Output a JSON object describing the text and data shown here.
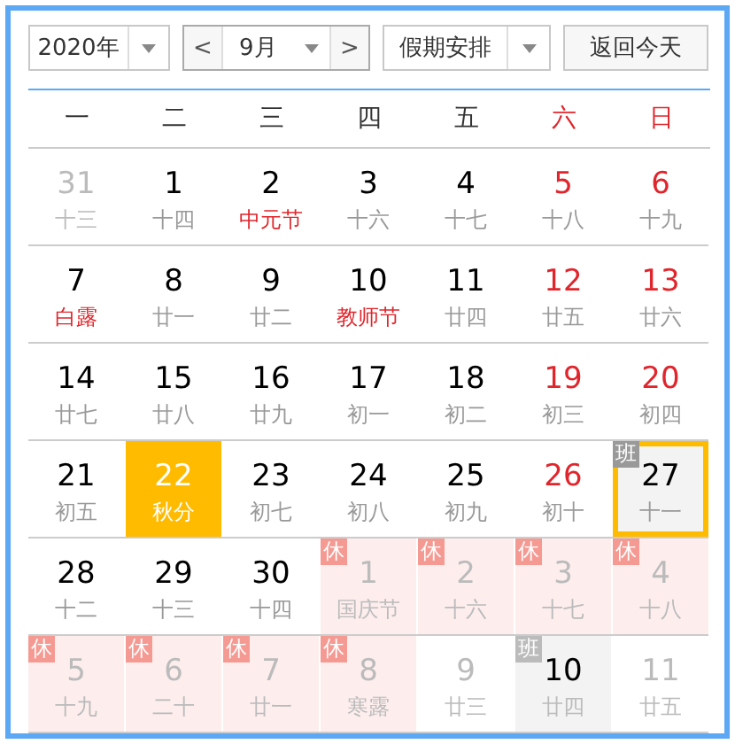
{
  "toolbar": {
    "year": {
      "value": "2020年"
    },
    "month": {
      "prev": "<",
      "value": "9月",
      "next": ">"
    },
    "holiday": {
      "value": "假期安排"
    },
    "today_button": "返回今天"
  },
  "weekdays": [
    {
      "label": "一",
      "weekend": false
    },
    {
      "label": "二",
      "weekend": false
    },
    {
      "label": "三",
      "weekend": false
    },
    {
      "label": "四",
      "weekend": false
    },
    {
      "label": "五",
      "weekend": false
    },
    {
      "label": "六",
      "weekend": true
    },
    {
      "label": "日",
      "weekend": true
    }
  ],
  "days": [
    {
      "kind": "normal",
      "day": "31",
      "lunar": "十三",
      "in_month": false,
      "festival": false,
      "selected": false,
      "highlighted": false,
      "today": false
    },
    {
      "kind": "normal",
      "day": "1",
      "lunar": "十四",
      "in_month": true,
      "weekend": false,
      "festival": false,
      "selected": false,
      "highlighted": false,
      "today": false
    },
    {
      "kind": "normal",
      "day": "2",
      "lunar": "中元节",
      "in_month": true,
      "weekend": false,
      "festival": true,
      "selected": false,
      "highlighted": false,
      "today": false
    },
    {
      "kind": "normal",
      "day": "3",
      "lunar": "十六",
      "in_month": true,
      "weekend": false,
      "festival": false,
      "selected": false,
      "highlighted": false,
      "today": false
    },
    {
      "kind": "normal",
      "day": "4",
      "lunar": "十七",
      "in_month": true,
      "weekend": false,
      "festival": false,
      "selected": false,
      "highlighted": false,
      "today": false
    },
    {
      "kind": "normal",
      "day": "5",
      "lunar": "十八",
      "in_month": true,
      "weekend": true,
      "festival": false,
      "selected": false,
      "highlighted": false,
      "today": false
    },
    {
      "kind": "normal",
      "day": "6",
      "lunar": "十九",
      "in_month": true,
      "weekend": true,
      "festival": false,
      "selected": false,
      "highlighted": false,
      "today": false
    },
    {
      "kind": "normal",
      "day": "7",
      "lunar": "白露",
      "in_month": true,
      "weekend": false,
      "festival": true,
      "selected": false,
      "highlighted": false,
      "today": false
    },
    {
      "kind": "normal",
      "day": "8",
      "lunar": "廿一",
      "in_month": true,
      "weekend": false,
      "festival": false,
      "selected": false,
      "highlighted": false,
      "today": false
    },
    {
      "kind": "normal",
      "day": "9",
      "lunar": "廿二",
      "in_month": true,
      "weekend": false,
      "festival": false,
      "selected": false,
      "highlighted": false,
      "today": false
    },
    {
      "kind": "normal",
      "day": "10",
      "lunar": "教师节",
      "in_month": true,
      "weekend": false,
      "festival": true,
      "selected": false,
      "highlighted": false,
      "today": false
    },
    {
      "kind": "normal",
      "day": "11",
      "lunar": "廿四",
      "in_month": true,
      "weekend": false,
      "festival": false,
      "selected": false,
      "highlighted": false,
      "today": false
    },
    {
      "kind": "normal",
      "day": "12",
      "lunar": "廿五",
      "in_month": true,
      "weekend": true,
      "festival": false,
      "selected": false,
      "highlighted": false,
      "today": false
    },
    {
      "kind": "normal",
      "day": "13",
      "lunar": "廿六",
      "in_month": true,
      "weekend": true,
      "festival": false,
      "selected": false,
      "highlighted": false,
      "today": false
    },
    {
      "kind": "normal",
      "day": "14",
      "lunar": "廿七",
      "in_month": true,
      "weekend": false,
      "festival": false,
      "selected": false,
      "highlighted": false,
      "today": false
    },
    {
      "kind": "normal",
      "day": "15",
      "lunar": "廿八",
      "in_month": true,
      "weekend": false,
      "festival": false,
      "selected": false,
      "highlighted": false,
      "today": false
    },
    {
      "kind": "normal",
      "day": "16",
      "lunar": "廿九",
      "in_month": true,
      "weekend": false,
      "festival": false,
      "selected": false,
      "highlighted": false,
      "today": false
    },
    {
      "kind": "normal",
      "day": "17",
      "lunar": "初一",
      "in_month": true,
      "weekend": false,
      "festival": false,
      "selected": false,
      "highlighted": false,
      "today": false
    },
    {
      "kind": "normal",
      "day": "18",
      "lunar": "初二",
      "in_month": true,
      "weekend": false,
      "festival": false,
      "selected": false,
      "highlighted": false,
      "today": false
    },
    {
      "kind": "normal",
      "day": "19",
      "lunar": "初三",
      "in_month": true,
      "weekend": true,
      "festival": false,
      "selected": false,
      "highlighted": false,
      "today": false
    },
    {
      "kind": "normal",
      "day": "20",
      "lunar": "初四",
      "in_month": true,
      "weekend": true,
      "festival": false,
      "selected": false,
      "highlighted": false,
      "today": false
    },
    {
      "kind": "normal",
      "day": "21",
      "lunar": "初五",
      "in_month": true,
      "weekend": false,
      "festival": false,
      "selected": false,
      "highlighted": false,
      "today": false
    },
    {
      "kind": "normal",
      "day": "22",
      "lunar": "秋分",
      "selected": true,
      "highlighted": false,
      "today": false
    },
    {
      "kind": "normal",
      "day": "23",
      "lunar": "初七",
      "in_month": true,
      "weekend": false,
      "festival": false,
      "selected": false,
      "highlighted": false,
      "today": false
    },
    {
      "kind": "normal",
      "day": "24",
      "lunar": "初八",
      "in_month": true,
      "weekend": false,
      "festival": false,
      "selected": false,
      "highlighted": false,
      "today": false
    },
    {
      "kind": "normal",
      "day": "25",
      "lunar": "初九",
      "in_month": true,
      "weekend": false,
      "festival": false,
      "selected": false,
      "highlighted": false,
      "today": false
    },
    {
      "kind": "normal",
      "day": "26",
      "lunar": "初十",
      "in_month": true,
      "weekend": true,
      "festival": false,
      "selected": false,
      "highlighted": false,
      "today": false
    },
    {
      "kind": "work",
      "badge": "班",
      "day": "27",
      "lunar": "十一",
      "in_month": true,
      "festival": false,
      "selected": false,
      "highlighted": true,
      "today": true
    },
    {
      "kind": "normal",
      "day": "28",
      "lunar": "十二",
      "in_month": true,
      "weekend": false,
      "festival": false,
      "selected": false,
      "highlighted": false,
      "today": false
    },
    {
      "kind": "normal",
      "day": "29",
      "lunar": "十三",
      "in_month": true,
      "weekend": false,
      "festival": false,
      "selected": false,
      "highlighted": false,
      "today": false
    },
    {
      "kind": "normal",
      "day": "30",
      "lunar": "十四",
      "in_month": true,
      "weekend": false,
      "festival": false,
      "selected": false,
      "highlighted": false,
      "today": false
    },
    {
      "kind": "rest",
      "badge": "休",
      "day": "1",
      "lunar": "国庆节",
      "in_month": false,
      "festival": true,
      "selected": false,
      "highlighted": false,
      "today": false
    },
    {
      "kind": "rest",
      "badge": "休",
      "day": "2",
      "lunar": "十六",
      "in_month": false,
      "festival": false,
      "selected": false,
      "highlighted": false,
      "today": false
    },
    {
      "kind": "rest",
      "badge": "休",
      "day": "3",
      "lunar": "十七",
      "in_month": false,
      "festival": false,
      "selected": false,
      "highlighted": false,
      "today": false
    },
    {
      "kind": "rest",
      "badge": "休",
      "day": "4",
      "lunar": "十八",
      "in_month": false,
      "festival": false,
      "selected": false,
      "highlighted": false,
      "today": false
    },
    {
      "kind": "rest",
      "badge": "休",
      "day": "5",
      "lunar": "十九",
      "in_month": false,
      "festival": false,
      "selected": false,
      "highlighted": false,
      "today": false
    },
    {
      "kind": "rest",
      "badge": "休",
      "day": "6",
      "lunar": "二十",
      "in_month": false,
      "festival": false,
      "selected": false,
      "highlighted": false,
      "today": false
    },
    {
      "kind": "rest",
      "badge": "休",
      "day": "7",
      "lunar": "廿一",
      "in_month": false,
      "festival": false,
      "selected": false,
      "highlighted": false,
      "today": false
    },
    {
      "kind": "rest",
      "badge": "休",
      "day": "8",
      "lunar": "寒露",
      "in_month": false,
      "festival": true,
      "selected": false,
      "highlighted": false,
      "today": false
    },
    {
      "kind": "normal",
      "day": "9",
      "lunar": "廿三",
      "in_month": false,
      "festival": false,
      "selected": false,
      "highlighted": false,
      "today": false
    },
    {
      "kind": "work",
      "badge": "班",
      "day": "10",
      "lunar": "廿四",
      "in_month": false,
      "festival": false,
      "selected": false,
      "highlighted": true,
      "today": false
    },
    {
      "kind": "normal",
      "day": "11",
      "lunar": "廿五",
      "in_month": false,
      "festival": false,
      "selected": false,
      "highlighted": false,
      "today": false
    }
  ]
}
